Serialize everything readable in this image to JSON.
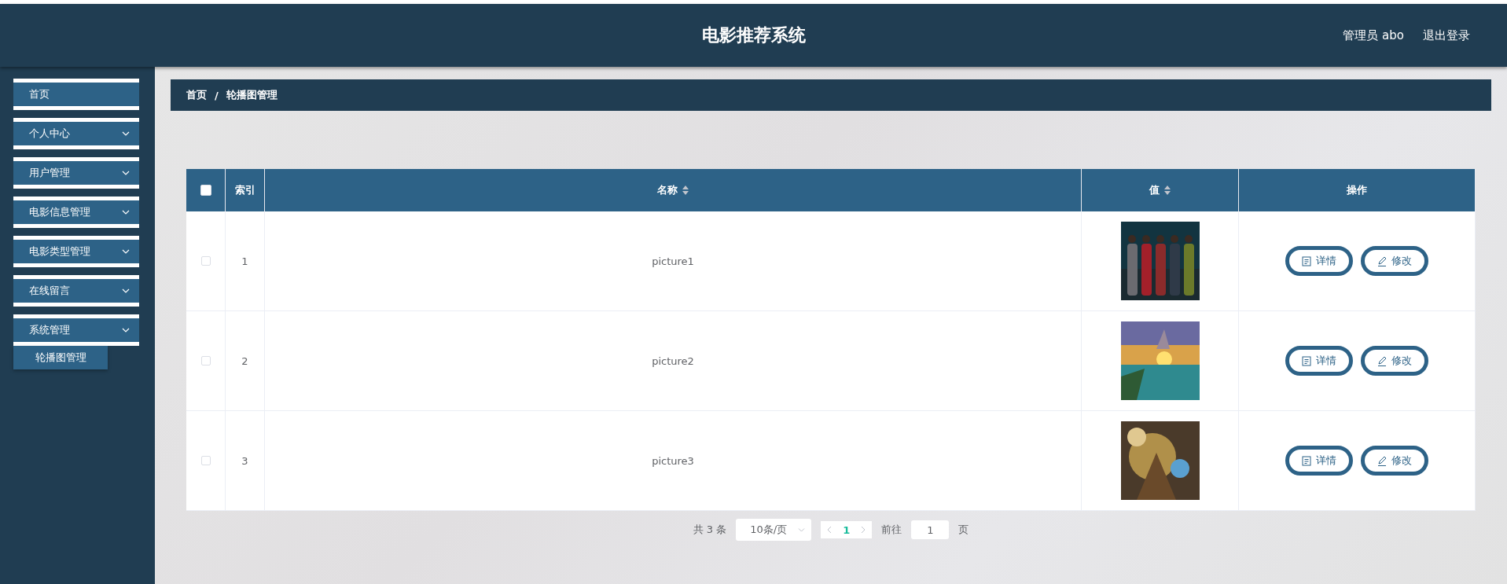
{
  "header": {
    "title": "电影推荐系统",
    "user": "管理员 abo",
    "logout": "退出登录"
  },
  "sidebar": {
    "items": [
      {
        "label": "首页",
        "kind": "link"
      },
      {
        "label": "个人中心",
        "kind": "submenu"
      },
      {
        "label": "用户管理",
        "kind": "submenu"
      },
      {
        "label": "电影信息管理",
        "kind": "submenu"
      },
      {
        "label": "电影类型管理",
        "kind": "submenu"
      },
      {
        "label": "在线留言",
        "kind": "submenu"
      },
      {
        "label": "系统管理",
        "kind": "submenu",
        "children": [
          {
            "label": "轮播图管理"
          }
        ]
      }
    ]
  },
  "breadcrumb": [
    "首页",
    "/",
    "轮播图管理"
  ],
  "table": {
    "header_checked": false,
    "columns": [
      {
        "label": "索引",
        "sortable": false
      },
      {
        "label": "名称",
        "sortable": true
      },
      {
        "label": "值",
        "sortable": true
      },
      {
        "label": "操作",
        "sortable": false
      }
    ],
    "rows": [
      {
        "selected": false,
        "index": "1",
        "name": "picture1",
        "value": {
          "kind": "picture"
        },
        "actions": [
          "详情",
          "修改"
        ]
      },
      {
        "selected": false,
        "index": "2",
        "name": "picture2",
        "value": {
          "kind": "picture"
        },
        "actions": [
          "详情",
          "修改"
        ]
      },
      {
        "selected": false,
        "index": "3",
        "name": "picture3",
        "value": {
          "kind": "picture"
        },
        "actions": [
          "详情",
          "修改"
        ]
      }
    ]
  },
  "pagination": {
    "total": "共 3 条",
    "page_size": "10条/页",
    "current_page": "1",
    "goto_label": "前往",
    "goto_value": "1",
    "goto_unit": "页"
  }
}
